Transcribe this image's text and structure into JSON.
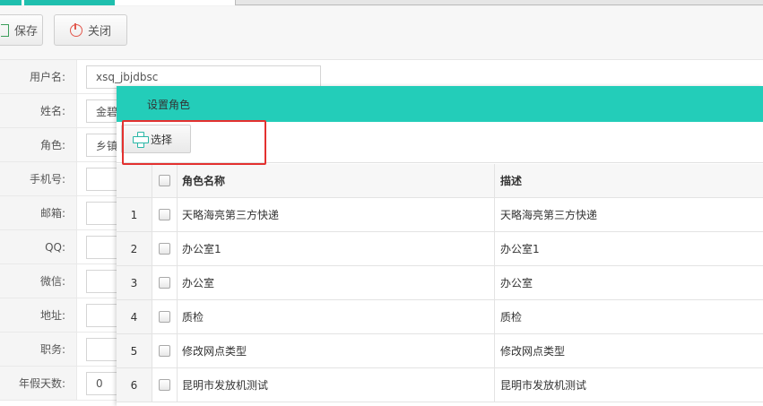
{
  "toolbar": {
    "save_label": "保存",
    "close_label": "关闭"
  },
  "form": {
    "fields": [
      {
        "label": "用户名:",
        "value": "xsq_jbjdbsc"
      },
      {
        "label": "姓名:",
        "value": "金碧"
      },
      {
        "label": "角色:",
        "value": "乡镇"
      },
      {
        "label": "手机号:",
        "value": ""
      },
      {
        "label": "邮箱:",
        "value": ""
      },
      {
        "label": "QQ:",
        "value": ""
      },
      {
        "label": "微信:",
        "value": ""
      },
      {
        "label": "地址:",
        "value": ""
      },
      {
        "label": "职务:",
        "value": ""
      },
      {
        "label": "年假天数:",
        "value": "0"
      }
    ]
  },
  "dialog": {
    "title": "设置角色",
    "select_label": "选择",
    "columns": {
      "name": "角色名称",
      "desc": "描述"
    },
    "rows": [
      {
        "num": "1",
        "name": "天略海亮第三方快递",
        "desc": "天略海亮第三方快递"
      },
      {
        "num": "2",
        "name": "办公室1",
        "desc": "办公室1"
      },
      {
        "num": "3",
        "name": "办公室",
        "desc": "办公室"
      },
      {
        "num": "4",
        "name": "质检",
        "desc": "质检"
      },
      {
        "num": "5",
        "name": "修改网点类型",
        "desc": "修改网点类型"
      },
      {
        "num": "6",
        "name": "昆明市发放机测试",
        "desc": "昆明市发放机测试"
      }
    ]
  },
  "colors": {
    "accent": "#23cdb9",
    "highlight": "#e3312f"
  }
}
